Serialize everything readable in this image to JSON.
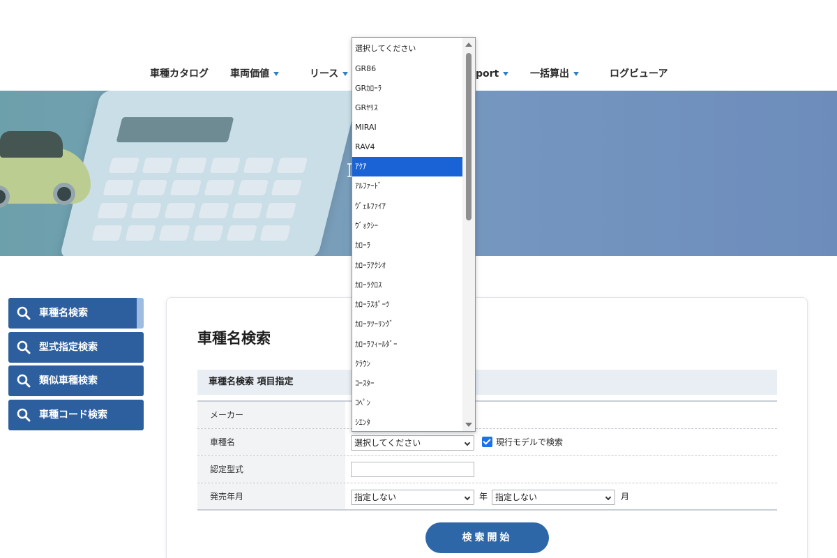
{
  "nav": {
    "items": [
      {
        "label": "車種カタログ",
        "dropdown": false
      },
      {
        "label": "車両価値",
        "dropdown": true
      },
      {
        "label": "リース",
        "dropdown": true
      },
      {
        "label": "port",
        "dropdown": true
      },
      {
        "label": "一括算出",
        "dropdown": true
      },
      {
        "label": "ログビューア",
        "dropdown": false
      }
    ]
  },
  "sidebar": {
    "items": [
      {
        "label": "車種名検索",
        "active": true
      },
      {
        "label": "型式指定検索",
        "active": false
      },
      {
        "label": "類似車種検索",
        "active": false
      },
      {
        "label": "車種コード検索",
        "active": false
      }
    ]
  },
  "main": {
    "title": "車種名検索",
    "section_title": "車種名検索 項目指定",
    "rows": {
      "maker": {
        "label": "メーカー"
      },
      "model": {
        "label": "車種名",
        "select_value": "選択してください",
        "checkbox_label": "現行モデルで検索",
        "checked": true
      },
      "type": {
        "label": "認定型式",
        "input_value": ""
      },
      "release": {
        "label": "発売年月",
        "year_value": "指定しない",
        "year_suffix": "年",
        "month_value": "指定しない",
        "month_suffix": "月"
      }
    },
    "search_button": "検索開始"
  },
  "dropdown": {
    "options": [
      "選択してください",
      "GR86",
      "GRｶﾛｰﾗ",
      "GRﾔﾘｽ",
      "MIRAI",
      "RAV4",
      "ｱｸｱ",
      "ｱﾙﾌｧｰﾄﾞ",
      "ｳﾞｪﾙﾌｧｲｱ",
      "ｳﾞｫｸｼｰ",
      "ｶﾛｰﾗ",
      "ｶﾛｰﾗｱｸｼｵ",
      "ｶﾛｰﾗｸﾛｽ",
      "ｶﾛｰﾗｽﾎﾟｰﾂ",
      "ｶﾛｰﾗﾂｰﾘﾝｸﾞ",
      "ｶﾛｰﾗﾌｨｰﾙﾀﾞｰ",
      "ｸﾗｳﾝ",
      "ｺｰｽﾀｰ",
      "ｺﾍﾟﾝ",
      "ｼｴﾝﾀ"
    ],
    "highlighted": "ｱｸｱ"
  },
  "colors": {
    "primary": "#2d5f9f",
    "button": "#2d67a8",
    "highlight": "#1a63d6",
    "caret": "#2f7fc4"
  }
}
